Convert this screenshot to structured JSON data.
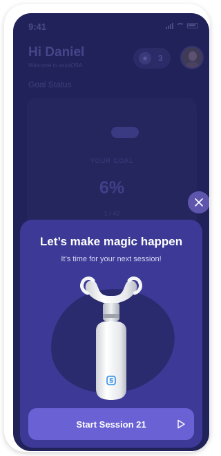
{
  "status_bar": {
    "time": "9:41"
  },
  "header": {
    "greeting": "Hi Daniel",
    "welcome": "Welcome to exxaOSA",
    "stars_count": "3"
  },
  "goal": {
    "section_title": "Goal Status",
    "your_goal_label": "YOUR GOAL",
    "percent": "6%",
    "fraction": "1 / 42",
    "progress_fraction": 0.06
  },
  "modal": {
    "title": "Let’s make magic happen",
    "subtitle": "It’s time for your next session!",
    "button_label": "Start Session 21"
  },
  "colors": {
    "background": "#22225a",
    "sheet": "#3c3a96",
    "accent": "#6a62d4",
    "device_logo": "#2f8fe6"
  }
}
